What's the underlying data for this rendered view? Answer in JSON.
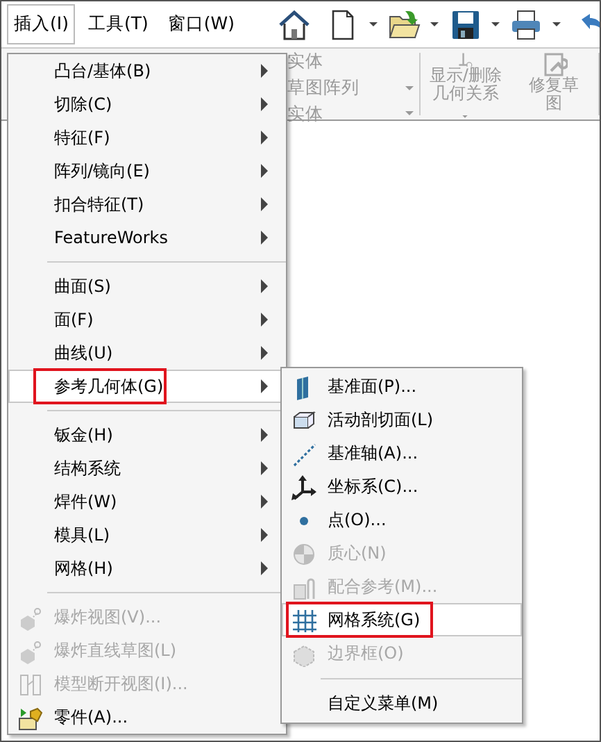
{
  "menubar": {
    "items": [
      {
        "label": "插入(I)",
        "selected": true
      },
      {
        "label": "工具(T)",
        "selected": false
      },
      {
        "label": "窗口(W)",
        "selected": false
      }
    ]
  },
  "ribbon": {
    "left_items": [
      {
        "label": "实体",
        "dropdown": false
      },
      {
        "label": "草图阵列",
        "dropdown": true
      },
      {
        "label": "实体",
        "dropdown": true
      }
    ],
    "buttons": [
      {
        "lines": [
          "显示/删除",
          "几何关系"
        ],
        "dropdown": true
      },
      {
        "lines": [
          "修复草",
          "图"
        ],
        "dropdown": false
      }
    ]
  },
  "menu": {
    "items": [
      {
        "kind": "item",
        "label": "凸台/基体(B)",
        "submenu": true,
        "disabled": false,
        "selected": false,
        "outlined": false
      },
      {
        "kind": "item",
        "label": "切除(C)",
        "submenu": true,
        "disabled": false,
        "selected": false,
        "outlined": false
      },
      {
        "kind": "item",
        "label": "特征(F)",
        "submenu": true,
        "disabled": false,
        "selected": false,
        "outlined": false
      },
      {
        "kind": "item",
        "label": "阵列/镜向(E)",
        "submenu": true,
        "disabled": false,
        "selected": false,
        "outlined": false
      },
      {
        "kind": "item",
        "label": "扣合特征(T)",
        "submenu": true,
        "disabled": false,
        "selected": false,
        "outlined": false
      },
      {
        "kind": "item",
        "label": "FeatureWorks",
        "submenu": true,
        "disabled": false,
        "selected": false,
        "outlined": false
      },
      {
        "kind": "separator"
      },
      {
        "kind": "item",
        "label": "曲面(S)",
        "submenu": true,
        "disabled": false,
        "selected": false,
        "outlined": false
      },
      {
        "kind": "item",
        "label": "面(F)",
        "submenu": true,
        "disabled": false,
        "selected": false,
        "outlined": false
      },
      {
        "kind": "item",
        "label": "曲线(U)",
        "submenu": true,
        "disabled": false,
        "selected": false,
        "outlined": false
      },
      {
        "kind": "item",
        "label": "参考几何体(G)",
        "submenu": true,
        "disabled": false,
        "selected": true,
        "outlined": true
      },
      {
        "kind": "separator"
      },
      {
        "kind": "item",
        "label": "钣金(H)",
        "submenu": true,
        "disabled": false,
        "selected": false,
        "outlined": false
      },
      {
        "kind": "item",
        "label": "结构系统",
        "submenu": true,
        "disabled": false,
        "selected": false,
        "outlined": false
      },
      {
        "kind": "item",
        "label": "焊件(W)",
        "submenu": true,
        "disabled": false,
        "selected": false,
        "outlined": false
      },
      {
        "kind": "item",
        "label": "模具(L)",
        "submenu": true,
        "disabled": false,
        "selected": false,
        "outlined": false
      },
      {
        "kind": "item",
        "label": "网格(H)",
        "submenu": true,
        "disabled": false,
        "selected": false,
        "outlined": false
      },
      {
        "kind": "separator"
      },
      {
        "kind": "item",
        "label": "爆炸视图(V)...",
        "submenu": false,
        "disabled": true,
        "selected": false,
        "outlined": false
      },
      {
        "kind": "item",
        "label": "爆炸直线草图(L)",
        "submenu": false,
        "disabled": true,
        "selected": false,
        "outlined": false
      },
      {
        "kind": "item",
        "label": "模型断开视图(I)...",
        "submenu": false,
        "disabled": true,
        "selected": false,
        "outlined": false
      },
      {
        "kind": "item",
        "label": "零件(A)...",
        "submenu": false,
        "disabled": false,
        "selected": false,
        "outlined": false
      }
    ]
  },
  "submenu": {
    "items": [
      {
        "kind": "item",
        "label": "基准面(P)...",
        "disabled": false,
        "selected": false,
        "outlined": false
      },
      {
        "kind": "item",
        "label": "活动剖切面(L)",
        "disabled": false,
        "selected": false,
        "outlined": false
      },
      {
        "kind": "item",
        "label": "基准轴(A)...",
        "disabled": false,
        "selected": false,
        "outlined": false
      },
      {
        "kind": "item",
        "label": "坐标系(C)...",
        "disabled": false,
        "selected": false,
        "outlined": false
      },
      {
        "kind": "item",
        "label": "点(O)...",
        "disabled": false,
        "selected": false,
        "outlined": false
      },
      {
        "kind": "item",
        "label": "质心(N)",
        "disabled": true,
        "selected": false,
        "outlined": false
      },
      {
        "kind": "item",
        "label": "配合参考(M)...",
        "disabled": true,
        "selected": false,
        "outlined": false
      },
      {
        "kind": "item",
        "label": "网格系统(G)",
        "disabled": false,
        "selected": true,
        "outlined": true
      },
      {
        "kind": "item",
        "label": "边界框(O)",
        "disabled": true,
        "selected": false,
        "outlined": false
      },
      {
        "kind": "separator"
      },
      {
        "kind": "item",
        "label": "自定义菜单(M)",
        "disabled": false,
        "selected": false,
        "outlined": false
      }
    ]
  }
}
